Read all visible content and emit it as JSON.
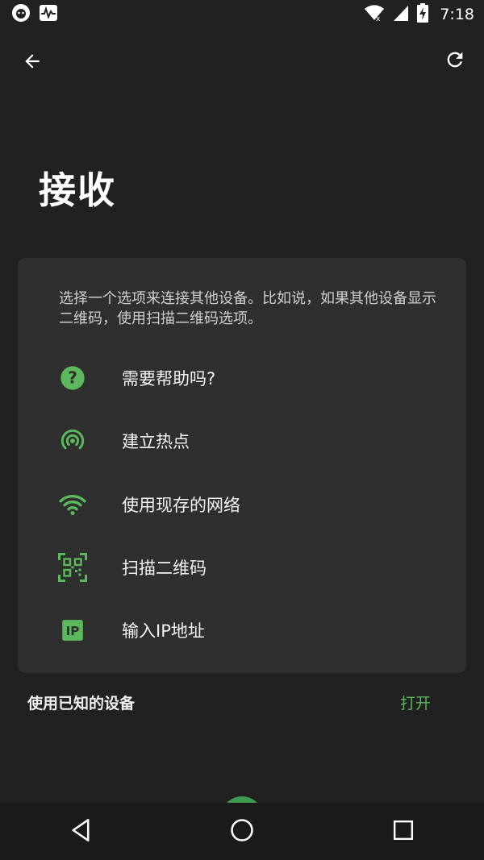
{
  "status_bar": {
    "time": "7:18",
    "icons": [
      "app-icon-badger",
      "activity-icon",
      "wifi-icon",
      "signal-icon",
      "battery-charging-icon"
    ]
  },
  "app_bar": {
    "back_icon": "arrow-left-icon",
    "refresh_icon": "refresh-icon"
  },
  "page": {
    "title": "接收"
  },
  "card": {
    "description": "选择一个选项来连接其他设备。比如说，如果其他设备显示二维码，使用扫描二维码选项。",
    "options": [
      {
        "label": "需要帮助吗?",
        "icon": "help-icon"
      },
      {
        "label": "建立热点",
        "icon": "hotspot-icon"
      },
      {
        "label": "使用现存的网络",
        "icon": "wifi-icon"
      },
      {
        "label": "扫描二维码",
        "icon": "qr-scan-icon"
      },
      {
        "label": "输入IP地址",
        "icon": "ip-icon"
      }
    ]
  },
  "known_devices": {
    "label": "使用已知的设备",
    "action": "打开"
  },
  "colors": {
    "background": "#212121",
    "card": "#2f2f2f",
    "accent": "#5cb85c"
  },
  "nav_bar": {
    "icons": [
      "back-triangle-icon",
      "home-circle-icon",
      "recents-square-icon"
    ]
  }
}
